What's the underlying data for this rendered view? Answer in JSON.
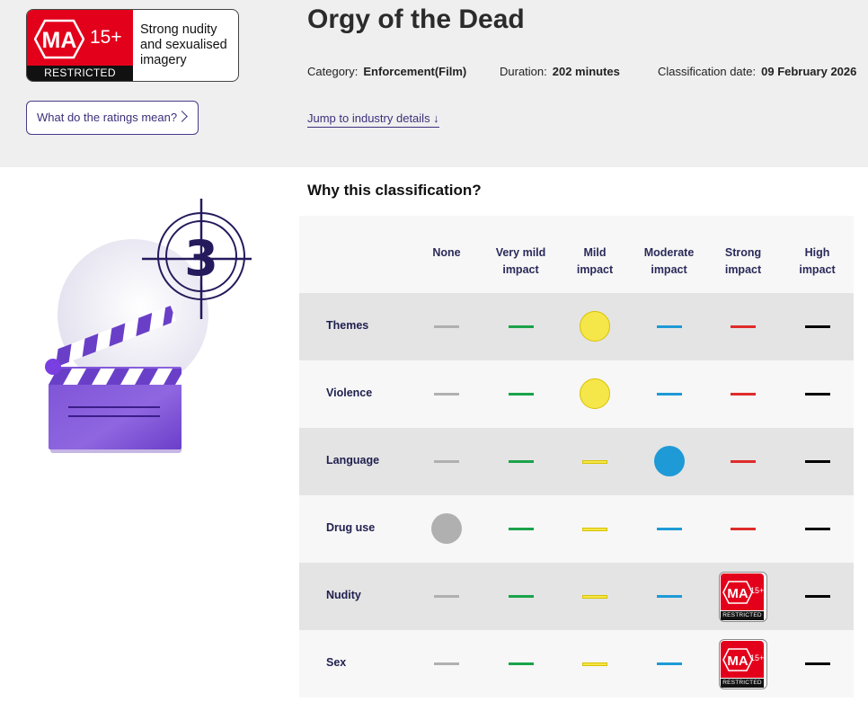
{
  "badge": {
    "rating": "MA",
    "age": "15+",
    "restricted": "RESTRICTED",
    "description": "Strong nudity and sexualised imagery",
    "colors": {
      "red": "#e3001b",
      "black": "#111111"
    }
  },
  "buttons": {
    "ratings_meaning": "What do the ratings mean?"
  },
  "title": "Orgy of the Dead",
  "meta": {
    "category_label": "Category:",
    "category_value": "Enforcement(Film)",
    "duration_label": "Duration:",
    "duration_value": "202 minutes",
    "date_label": "Classification date:",
    "date_value": "09 February 2026"
  },
  "links": {
    "jump": "Jump to industry details ↓"
  },
  "section": {
    "why": "Why this classification?"
  },
  "illustration": {
    "countdown_number": "3",
    "icon": "clapperboard-icon"
  },
  "table": {
    "columns": [
      {
        "key": "none",
        "l1": "None",
        "l2": "",
        "color": "#b0b0b0"
      },
      {
        "key": "very_mild",
        "l1": "Very mild",
        "l2": "impact",
        "color": "#1aa34a"
      },
      {
        "key": "mild",
        "l1": "Mild",
        "l2": "impact",
        "color": "#f5e64a"
      },
      {
        "key": "moderate",
        "l1": "Moderate",
        "l2": "impact",
        "color": "#1e9ad6"
      },
      {
        "key": "strong",
        "l1": "Strong",
        "l2": "impact",
        "color": "#e02b2b"
      },
      {
        "key": "high",
        "l1": "High",
        "l2": "impact",
        "color": "#000000"
      }
    ],
    "rows": [
      {
        "label": "Themes",
        "level": "mild",
        "marker": "dot"
      },
      {
        "label": "Violence",
        "level": "mild",
        "marker": "dot"
      },
      {
        "label": "Language",
        "level": "moderate",
        "marker": "dot"
      },
      {
        "label": "Drug use",
        "level": "none",
        "marker": "dot"
      },
      {
        "label": "Nudity",
        "level": "strong",
        "marker": "badge"
      },
      {
        "label": "Sex",
        "level": "strong",
        "marker": "badge"
      }
    ]
  }
}
